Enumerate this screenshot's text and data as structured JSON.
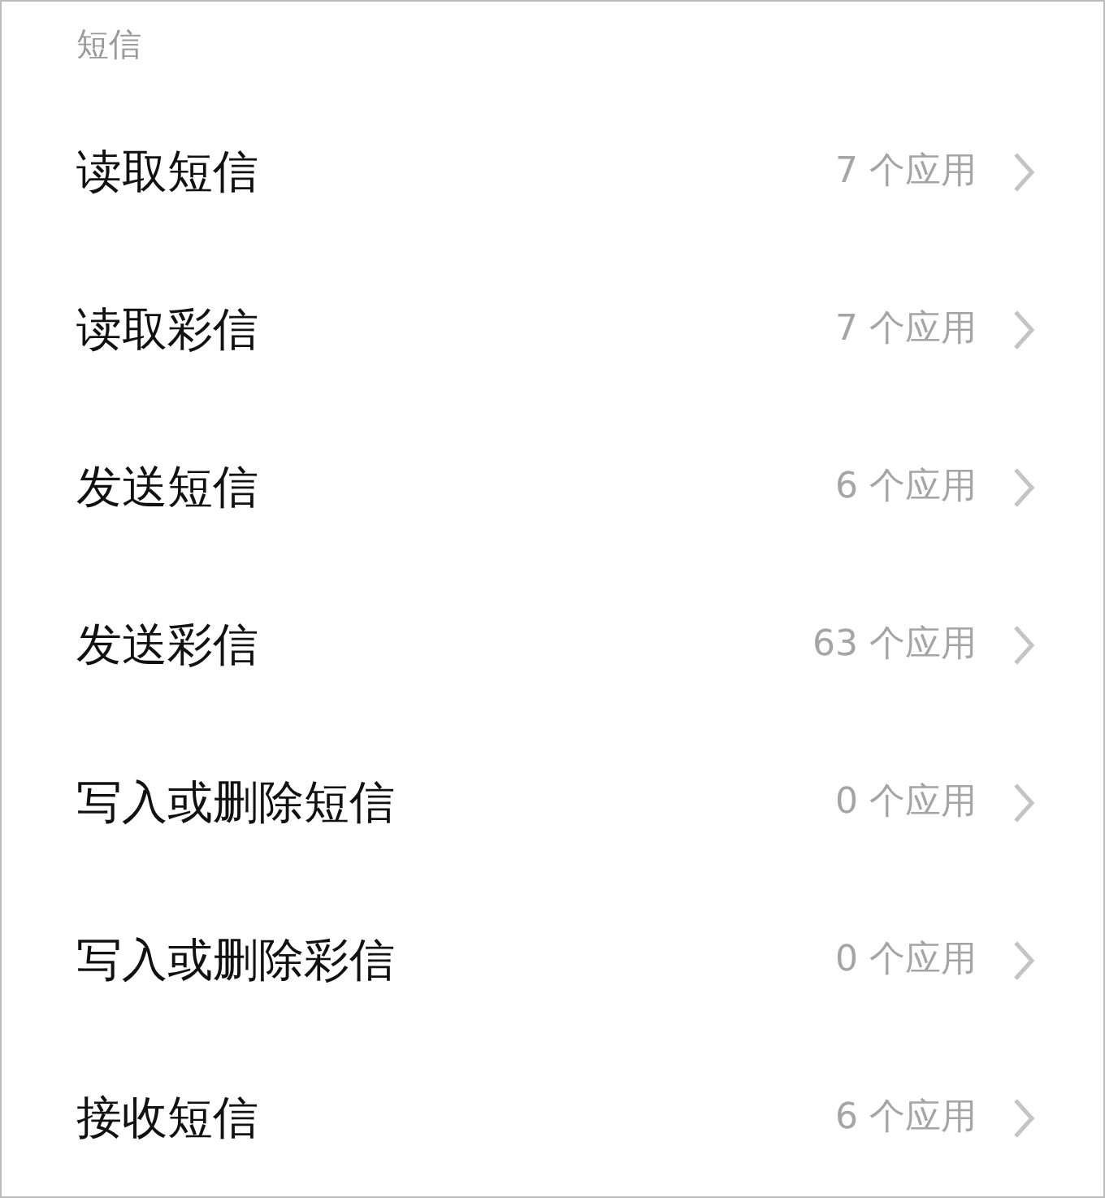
{
  "section_title": "短信",
  "items": [
    {
      "label": "读取短信",
      "count": "7 个应用"
    },
    {
      "label": "读取彩信",
      "count": "7 个应用"
    },
    {
      "label": "发送短信",
      "count": "6 个应用"
    },
    {
      "label": "发送彩信",
      "count": "63 个应用"
    },
    {
      "label": "写入或删除短信",
      "count": "0 个应用"
    },
    {
      "label": "写入或删除彩信",
      "count": "0 个应用"
    },
    {
      "label": "接收短信",
      "count": "6 个应用"
    }
  ]
}
